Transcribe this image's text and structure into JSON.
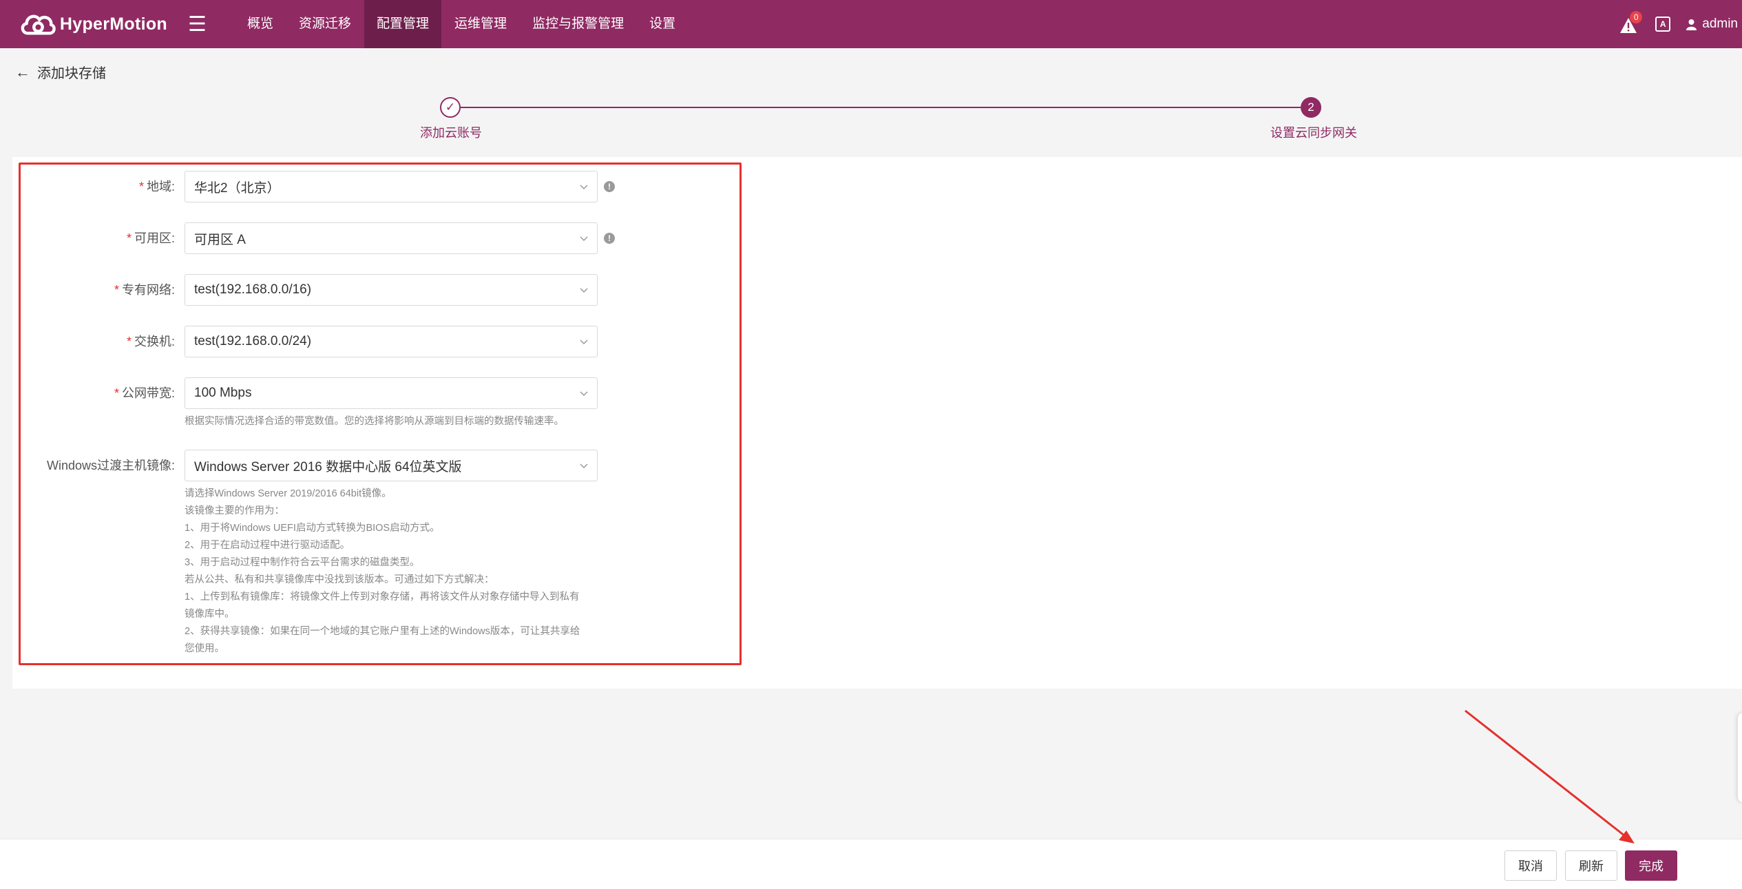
{
  "app": {
    "name": "HyperMotion"
  },
  "nav": {
    "items": [
      {
        "label": "概览"
      },
      {
        "label": "资源迁移"
      },
      {
        "label": "配置管理"
      },
      {
        "label": "运维管理"
      },
      {
        "label": "监控与报警管理"
      },
      {
        "label": "设置"
      }
    ],
    "active_index": 2
  },
  "topbar": {
    "alert_count": "0",
    "lang_icon": "A",
    "user": "admin"
  },
  "page": {
    "title": "添加块存储"
  },
  "steps": [
    {
      "label": "添加云账号",
      "status": "done",
      "marker": "✓"
    },
    {
      "label": "设置云同步网关",
      "status": "active",
      "marker": "2"
    }
  ],
  "form": {
    "required_mark": "*",
    "fields": [
      {
        "label": "地域:",
        "value": "华北2（北京）",
        "required": true,
        "info": true
      },
      {
        "label": "可用区:",
        "value": "可用区 A",
        "required": true,
        "info": true
      },
      {
        "label": "专有网络:",
        "value": "test(192.168.0.0/16)",
        "required": true,
        "info": false
      },
      {
        "label": "交换机:",
        "value": "test(192.168.0.0/24)",
        "required": true,
        "info": false
      },
      {
        "label": "公网带宽:",
        "value": "100 Mbps",
        "required": true,
        "info": false,
        "hint": [
          "根据实际情况选择合适的带宽数值。您的选择将影响从源端到目标端的数据传输速率。"
        ]
      },
      {
        "label": "Windows过渡主机镜像:",
        "value": "Windows Server  2016 数据中心版 64位英文版",
        "required": false,
        "info": false,
        "hint": [
          "请选择Windows Server 2019/2016 64bit镜像。",
          "该镜像主要的作用为：",
          "1、用于将Windows UEFI启动方式转换为BIOS启动方式。",
          "2、用于在启动过程中进行驱动适配。",
          "3、用于启动过程中制作符合云平台需求的磁盘类型。",
          "若从公共、私有和共享镜像库中没找到该版本。可通过如下方式解决：",
          "1、上传到私有镜像库：将镜像文件上传到对象存储，再将该文件从对象存储中导入到私有",
          "镜像库中。",
          "2、获得共享镜像：如果在同一个地域的其它账户里有上述的Windows版本，可让其共享给",
          "您使用。"
        ]
      }
    ]
  },
  "info_icon_glyph": "!",
  "footer": {
    "cancel": "取消",
    "refresh": "刷新",
    "finish": "完成"
  },
  "colors": {
    "brand": "#8f2a62",
    "brand_dark": "#6e1e4b",
    "highlight": "#e5302b"
  }
}
